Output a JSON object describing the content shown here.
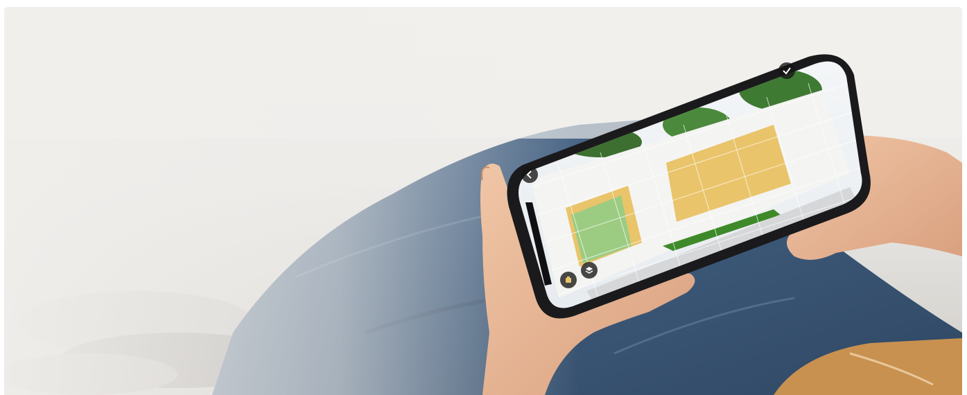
{
  "image": {
    "subject": "hands-holding-phone-ar-house-paint-preview",
    "icons": {
      "back": "chevron-left-icon",
      "confirm": "check-icon",
      "tool_paint": "paint-palette-icon",
      "tool_shape": "layers-icon"
    },
    "colors": {
      "wall_yellow": "#e9c46a",
      "door_green": "#9ccc82",
      "denim": "#3e5a7a",
      "skin": "#e7b795",
      "jacket": "#c8914f"
    }
  }
}
